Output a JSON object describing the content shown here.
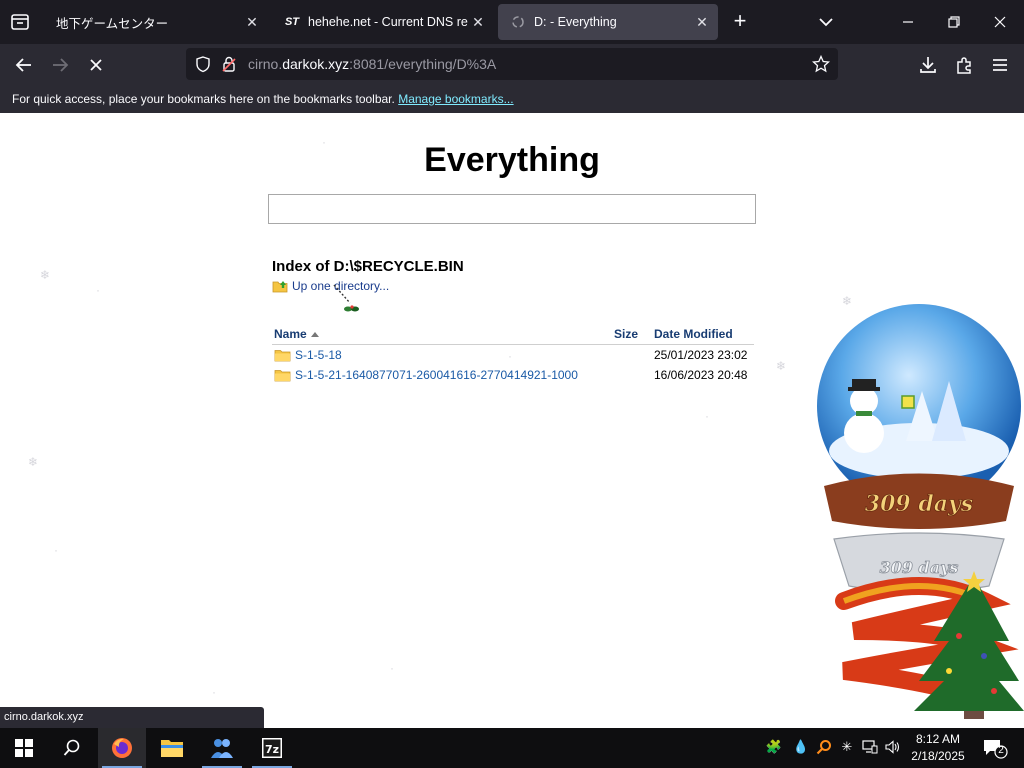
{
  "browser": {
    "tabs": [
      {
        "title": "地下ゲームセンター",
        "favicon": "blank"
      },
      {
        "title": "hehehe.net - Current DNS reco",
        "favicon": "ST"
      },
      {
        "title": "D: - Everything",
        "favicon": "loading"
      }
    ],
    "active_tab_index": 2,
    "url_domain": "cirno.darkok.xyz",
    "url_rest": ":8081/everything/D%3A",
    "url_prefix": "cirno.",
    "url_host": "darkok.xyz",
    "bookmarks_message": "For quick access, place your bookmarks here on the bookmarks toolbar.",
    "bookmarks_link": "Manage bookmarks...",
    "status_text": "cirno.darkok.xyz"
  },
  "page": {
    "title": "Everything",
    "search_value": "",
    "index_heading": "Index of D:\\$RECYCLE.BIN",
    "up_link": "Up one directory...",
    "columns": {
      "name": "Name",
      "size": "Size",
      "date": "Date Modified"
    },
    "rows": [
      {
        "name": "S-1-5-18",
        "size": "",
        "date": "25/01/2023 23:02"
      },
      {
        "name": "S-1-5-21-1640877071-260041616-2770414921-1000",
        "size": "",
        "date": "16/06/2023 20:48"
      }
    ],
    "globe_label": "309 days",
    "globe_base_label": "309 days"
  },
  "taskbar": {
    "time": "8:12 AM",
    "date": "2/18/2025",
    "notification_count": "2",
    "apps": [
      "windows-start",
      "search",
      "firefox",
      "file-explorer",
      "people-app",
      "7zip"
    ]
  },
  "colors": {
    "tabstrip": "#1c1b22",
    "navbar": "#2b2a33",
    "link": "#1a5aa6",
    "accent_link": "#80ebff"
  }
}
